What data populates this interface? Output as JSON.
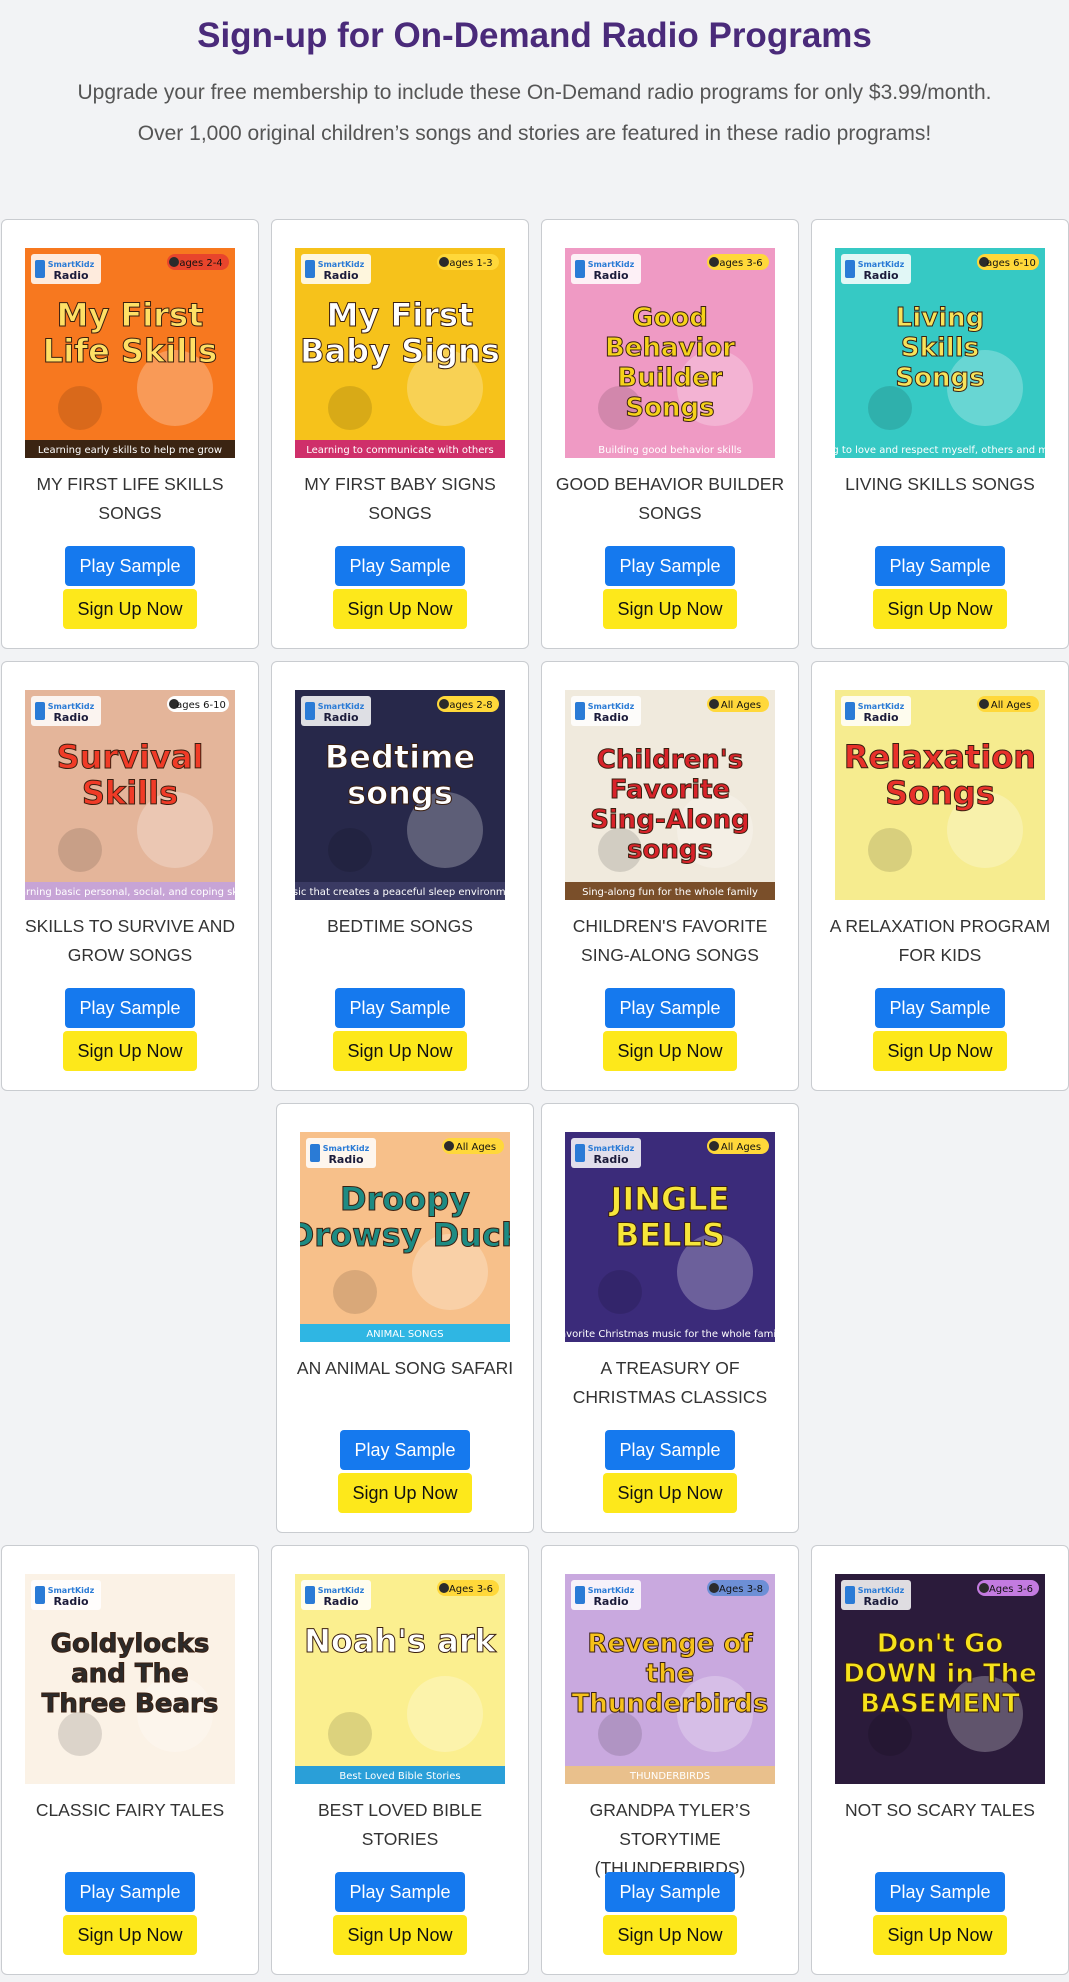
{
  "header": {
    "title": "Sign-up for On-Demand Radio Programs",
    "line1": "Upgrade your free membership to include these On-Demand radio programs for only $3.99/month.",
    "line2": "Over 1,000 original children’s songs and stories are featured in these radio programs!"
  },
  "buttons": {
    "play": "Play Sample",
    "signup": "Sign Up Now"
  },
  "programs": [
    {
      "title": "MY FIRST LIFE SKILLS SONGS",
      "cover": {
        "bg": "#f7781f",
        "art": "My First Life Skills",
        "art_color": "#ffe066",
        "badge": "ages 2-4",
        "badge_bg": "#e8452c",
        "footer": "Learning early skills to help me grow",
        "footer_bg": "#3b2412"
      }
    },
    {
      "title": "MY FIRST BABY SIGNS SONGS",
      "cover": {
        "bg": "#f6c21b",
        "art": "My First Baby Signs",
        "art_color": "#ffffff",
        "badge": "ages 1-3",
        "badge_bg": "#ffd83a",
        "footer": "Learning to communicate with others",
        "footer_bg": "#cf2f6a"
      }
    },
    {
      "title": "GOOD BEHAVIOR BUILDER SONGS",
      "cover": {
        "bg": "#ef9ac4",
        "art": "Good Behavior Builder Songs",
        "art_color": "#f5d21a",
        "badge": "ages 3-6",
        "badge_bg": "#ffd83a",
        "footer": "Building good behavior skills",
        "footer_bg": "#ef9ac4"
      }
    },
    {
      "title": "LIVING SKILLS SONGS",
      "cover": {
        "bg": "#36c9c4",
        "art": "Living Skills Songs",
        "art_color": "#f7e35a",
        "badge": "ages 6-10",
        "badge_bg": "#ffd83a",
        "footer": "Learning to love and respect myself, others and my world",
        "footer_bg": "#36c9c4"
      }
    },
    {
      "title": "SKILLS TO SURVIVE AND GROW SONGS",
      "cover": {
        "bg": "#e4b59a",
        "art": "Survival Skills",
        "art_color": "#f03b27",
        "badge": "ages 6-10",
        "badge_bg": "#ffffff",
        "footer": "Learning basic personal, social, and coping skills",
        "footer_bg": "#c7a4d6"
      }
    },
    {
      "title": "BEDTIME SONGS",
      "cover": {
        "bg": "#27284a",
        "art": "Bedtime songs",
        "art_color": "#ffffff",
        "badge": "ages 2-8",
        "badge_bg": "#ffd83a",
        "footer": "Music that creates a peaceful sleep environment",
        "footer_bg": "#3a3a63"
      }
    },
    {
      "title": "CHILDREN'S FAVORITE SING-ALONG SONGS",
      "cover": {
        "bg": "#f0eadd",
        "art": "Children's Favorite Sing-Along songs",
        "art_color": "#d8232a",
        "badge": "All Ages",
        "badge_bg": "#ffd83a",
        "footer": "Sing-along fun for the whole family",
        "footer_bg": "#7a4f2a"
      }
    },
    {
      "title": "A RELAXATION PROGRAM FOR KIDS",
      "cover": {
        "bg": "#f6ec8f",
        "art": "Relaxation Songs",
        "art_color": "#e8312a",
        "badge": "All Ages",
        "badge_bg": "#ffd83a",
        "footer": "",
        "footer_bg": "#f6ec8f"
      }
    },
    {
      "title": "AN ANIMAL SONG SAFARI",
      "cover": {
        "bg": "#f7c08a",
        "art": "Droopy Drowsy Duck",
        "art_color": "#1d8b83",
        "badge": "All Ages",
        "badge_bg": "#ffd83a",
        "footer": "ANIMAL SONGS",
        "footer_bg": "#2fb6e3"
      }
    },
    {
      "title": "A TREASURY OF CHRISTMAS CLASSICS",
      "cover": {
        "bg": "#3b2b7a",
        "art": "JINGLE BELLS",
        "art_color": "#f7e63a",
        "badge": "All Ages",
        "badge_bg": "#ffd83a",
        "footer": "Favorite Christmas music for the whole family",
        "footer_bg": "#3b2b7a"
      }
    },
    {
      "title": "CLASSIC FAIRY TALES",
      "cover": {
        "bg": "#fbf2e6",
        "art": "Goldylocks and The Three Bears",
        "art_color": "#2b2b2b",
        "badge": "",
        "badge_bg": "#ffd83a",
        "footer": "",
        "footer_bg": "#fbf2e6"
      }
    },
    {
      "title": "BEST LOVED BIBLE STORIES",
      "cover": {
        "bg": "#fbef8f",
        "art": "Noah's ark",
        "art_color": "#ffffff",
        "badge": "Ages 3-6",
        "badge_bg": "#ffd83a",
        "footer": "Best Loved Bible Stories",
        "footer_bg": "#2a9fd8"
      }
    },
    {
      "title": "GRANDPA TYLER’S STORYTIME (THUNDERBIRDS)",
      "cover": {
        "bg": "#c9a9df",
        "art": "Revenge of the Thunderbirds",
        "art_color": "#f6c21b",
        "badge": "Ages 3-8",
        "badge_bg": "#6d8fd6",
        "footer": "THUNDERBIRDS",
        "footer_bg": "#e9c08c"
      }
    },
    {
      "title": "NOT SO SCARY TALES",
      "cover": {
        "bg": "#2b1b3b",
        "art": "Don't Go DOWN in The BASEMENT",
        "art_color": "#f6e21b",
        "badge": "Ages 3-6",
        "badge_bg": "#c37be0",
        "footer": "",
        "footer_bg": "#2b1b3b"
      }
    }
  ]
}
